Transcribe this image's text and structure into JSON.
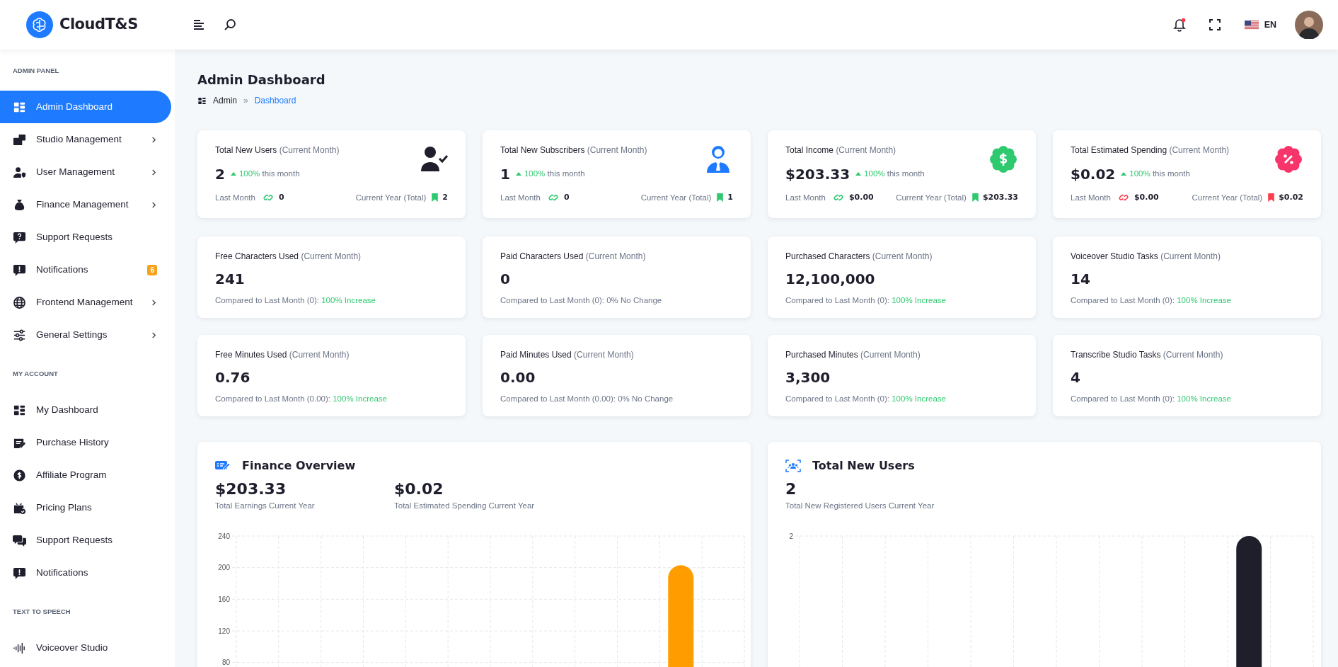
{
  "header": {
    "logo_text": "CloudT&S",
    "language": "EN",
    "has_unread_notifications": true
  },
  "sidebar": {
    "sections": [
      {
        "title": "ADMIN PANEL",
        "items": [
          {
            "label": "Admin Dashboard",
            "selected": true,
            "has_submenu": false
          },
          {
            "label": "Studio Management",
            "selected": false,
            "has_submenu": true
          },
          {
            "label": "User Management",
            "selected": false,
            "has_submenu": true
          },
          {
            "label": "Finance Management",
            "selected": false,
            "has_submenu": true
          },
          {
            "label": "Support Requests",
            "selected": false,
            "has_submenu": false
          },
          {
            "label": "Notifications",
            "selected": false,
            "has_submenu": false,
            "badge": "6"
          },
          {
            "label": "Frontend Management",
            "selected": false,
            "has_submenu": true
          },
          {
            "label": "General Settings",
            "selected": false,
            "has_submenu": true
          }
        ]
      },
      {
        "title": "MY ACCOUNT",
        "items": [
          {
            "label": "My Dashboard",
            "selected": false,
            "has_submenu": false
          },
          {
            "label": "Purchase History",
            "selected": false,
            "has_submenu": false
          },
          {
            "label": "Affiliate Program",
            "selected": false,
            "has_submenu": false
          },
          {
            "label": "Pricing Plans",
            "selected": false,
            "has_submenu": false
          },
          {
            "label": "Support Requests",
            "selected": false,
            "has_submenu": false
          },
          {
            "label": "Notifications",
            "selected": false,
            "has_submenu": false
          }
        ]
      },
      {
        "title": "TEXT TO SPEECH",
        "items": [
          {
            "label": "Voiceover Studio",
            "selected": false,
            "has_submenu": false
          }
        ]
      }
    ]
  },
  "page": {
    "title": "Admin Dashboard",
    "breadcrumb": {
      "separator": "»",
      "items": [
        {
          "label": "Admin",
          "current": false
        },
        {
          "label": "Dashboard",
          "current": true
        }
      ]
    }
  },
  "summary_cards": [
    {
      "title": "Total New Users",
      "qualifier": "(Current Month)",
      "value": "2",
      "change": "100%",
      "change_suffix": "this month",
      "last_month_label": "Last Month",
      "last_month_value": "0",
      "year_label": "Current Year (Total)",
      "year_value": "2",
      "color": "#2fc96f"
    },
    {
      "title": "Total New Subscribers",
      "qualifier": "(Current Month)",
      "value": "1",
      "change": "100%",
      "change_suffix": "this month",
      "last_month_label": "Last Month",
      "last_month_value": "0",
      "year_label": "Current Year (Total)",
      "year_value": "1",
      "color": "#2fc96f"
    },
    {
      "title": "Total Income",
      "qualifier": "(Current Month)",
      "value": "$203.33",
      "change": "100%",
      "change_suffix": "this month",
      "last_month_label": "Last Month",
      "last_month_value": "$0.00",
      "year_label": "Current Year (Total)",
      "year_value": "$203.33",
      "color": "#2fc96f"
    },
    {
      "title": "Total Estimated Spending",
      "qualifier": "(Current Month)",
      "value": "$0.02",
      "change": "100%",
      "change_suffix": "this month",
      "last_month_label": "Last Month",
      "last_month_value": "$0.00",
      "year_label": "Current Year (Total)",
      "year_value": "$0.02",
      "color": "#ff3b4e"
    }
  ],
  "usage_cards": [
    {
      "title": "Free Characters Used",
      "qualifier": "(Current Month)",
      "value": "241",
      "comparison": "Compared to Last Month (0):",
      "result": "100% Increase",
      "increase": true
    },
    {
      "title": "Paid Characters Used",
      "qualifier": "(Current Month)",
      "value": "0",
      "comparison": "Compared to Last Month (0):",
      "result": "0% No Change",
      "increase": false
    },
    {
      "title": "Purchased Characters",
      "qualifier": "(Current Month)",
      "value": "12,100,000",
      "comparison": "Compared to Last Month (0):",
      "result": "100% Increase",
      "increase": true
    },
    {
      "title": "Voiceover Studio Tasks",
      "qualifier": "(Current Month)",
      "value": "14",
      "comparison": "Compared to Last Month (0):",
      "result": "100% Increase",
      "increase": true
    },
    {
      "title": "Free Minutes Used",
      "qualifier": "(Current Month)",
      "value": "0.76",
      "comparison": "Compared to Last Month (0.00):",
      "result": "100% Increase",
      "increase": true
    },
    {
      "title": "Paid Minutes Used",
      "qualifier": "(Current Month)",
      "value": "0.00",
      "comparison": "Compared to Last Month (0.00):",
      "result": "0% No Change",
      "increase": false
    },
    {
      "title": "Purchased Minutes",
      "qualifier": "(Current Month)",
      "value": "3,300",
      "comparison": "Compared to Last Month (0):",
      "result": "100% Increase",
      "increase": true
    },
    {
      "title": "Transcribe Studio Tasks",
      "qualifier": "(Current Month)",
      "value": "4",
      "comparison": "Compared to Last Month (0):",
      "result": "100% Increase",
      "increase": true
    }
  ],
  "panels": [
    {
      "title": "Finance Overview",
      "stats": [
        {
          "value": "$203.33",
          "label": "Total Earnings Current Year"
        },
        {
          "value": "$0.02",
          "label": "Total Estimated Spending Current Year"
        }
      ],
      "chart_data": {
        "type": "bar",
        "grid": true,
        "values": [
          0,
          0,
          0,
          0,
          0,
          0,
          0,
          0,
          0,
          0,
          203,
          0
        ],
        "ylim": [
          0,
          240
        ],
        "yticks": [
          80,
          120,
          160,
          200,
          240
        ]
      }
    },
    {
      "title": "Total New Users",
      "stats": [
        {
          "value": "2",
          "label": "Total New Registered Users Current Year"
        }
      ],
      "chart_picture": {
        "axis_label": "2"
      }
    }
  ]
}
